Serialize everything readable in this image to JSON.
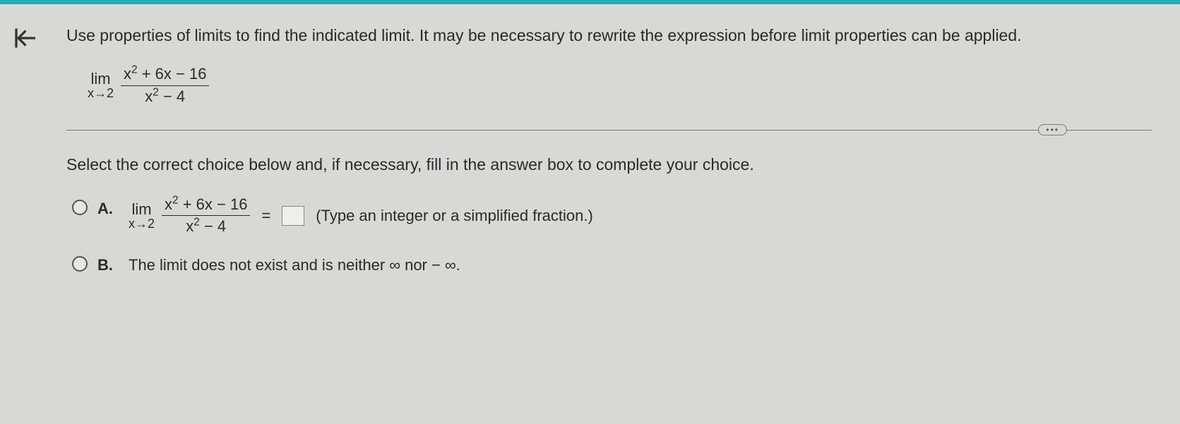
{
  "question": "Use properties of limits to find the indicated limit. It may be necessary to rewrite the expression before limit properties can be applied.",
  "limit": {
    "lim_label": "lim",
    "approach": "x→2",
    "numerator_a": "x",
    "numerator_exp": "2",
    "numerator_rest": " + 6x − 16",
    "denominator_a": "x",
    "denominator_exp": "2",
    "denominator_rest": " − 4"
  },
  "ellipsis": "•••",
  "instruction": "Select the correct choice below and, if necessary, fill in the answer box to complete your choice.",
  "choices": {
    "a": {
      "label": "A.",
      "equals": "=",
      "hint": "(Type an integer or a simplified fraction.)"
    },
    "b": {
      "label": "B.",
      "text": "The limit does not exist and is neither ∞ nor − ∞."
    }
  }
}
